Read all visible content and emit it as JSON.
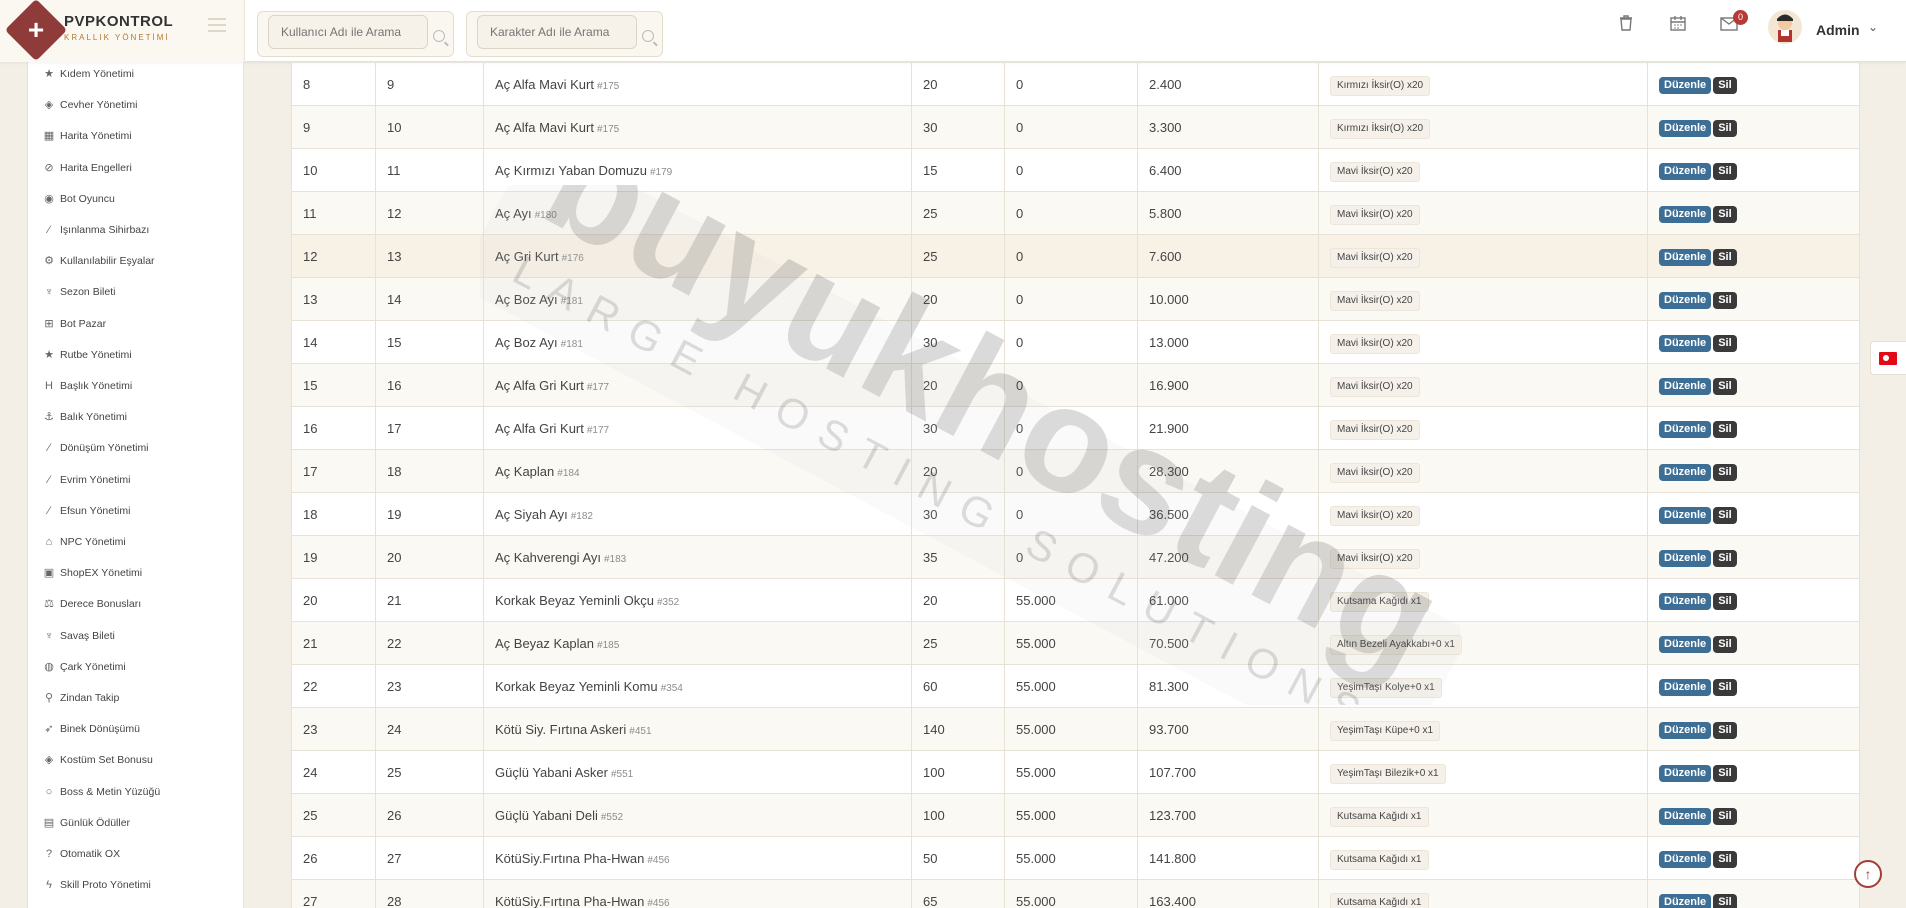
{
  "brand": {
    "title": "PVPKONTROL",
    "subtitle": "KRALLIK YÖNETİMİ"
  },
  "header": {
    "user_search_placeholder": "Kullanıcı Adı ile Arama",
    "char_search_placeholder": "Karakter Adı ile Arama",
    "notification_count": "0",
    "user_name": "Admin"
  },
  "sidebar": {
    "items": [
      {
        "label": "Kıdem Yönetimi",
        "icon": "star-icon"
      },
      {
        "label": "Cevher Yönetimi",
        "icon": "gem-icon"
      },
      {
        "label": "Harita Yönetimi",
        "icon": "map-icon"
      },
      {
        "label": "Harita Engelleri",
        "icon": "ban-icon"
      },
      {
        "label": "Bot Oyuncu",
        "icon": "bot-icon"
      },
      {
        "label": "Işınlanma Sihirbazı",
        "icon": "wand-icon"
      },
      {
        "label": "Kullanılabilir Eşyalar",
        "icon": "cogs-icon"
      },
      {
        "label": "Sezon Bileti",
        "icon": "trophy-icon"
      },
      {
        "label": "Bot Pazar",
        "icon": "cart-icon"
      },
      {
        "label": "Rutbe Yönetimi",
        "icon": "star-icon"
      },
      {
        "label": "Başlık Yönetimi",
        "icon": "heading-icon"
      },
      {
        "label": "Balık Yönetimi",
        "icon": "anchor-icon"
      },
      {
        "label": "Dönüşüm Yönetimi",
        "icon": "wand-icon"
      },
      {
        "label": "Evrim Yönetimi",
        "icon": "wand-icon"
      },
      {
        "label": "Efsun Yönetimi",
        "icon": "wand-icon"
      },
      {
        "label": "NPC Yönetimi",
        "icon": "bank-icon"
      },
      {
        "label": "ShopEX Yönetimi",
        "icon": "shop-icon"
      },
      {
        "label": "Derece Bonusları",
        "icon": "scale-icon"
      },
      {
        "label": "Savaş Bileti",
        "icon": "trophy-icon"
      },
      {
        "label": "Çark Yönetimi",
        "icon": "globe-icon"
      },
      {
        "label": "Zindan Takip",
        "icon": "pin-icon"
      },
      {
        "label": "Binek Dönüşümü",
        "icon": "rocket-icon"
      },
      {
        "label": "Kostüm Set Bonusu",
        "icon": "gem-icon"
      },
      {
        "label": "Boss & Metin Yüzüğü",
        "icon": "ring-icon"
      },
      {
        "label": "Günlük Ödüller",
        "icon": "calendar-icon"
      },
      {
        "label": "Otomatik OX",
        "icon": "question-icon"
      },
      {
        "label": "Skill Proto Yönetimi",
        "icon": "bolt-icon"
      }
    ]
  },
  "table": {
    "rows": [
      {
        "no": "8",
        "level": "9",
        "mob": "Aç Alfa Mavi Kurt",
        "mob_id": "#175",
        "count": "20",
        "yang": "0",
        "exp": "2.400",
        "item": "Kırmızı İksir(O) x20"
      },
      {
        "no": "9",
        "level": "10",
        "mob": "Aç Alfa Mavi Kurt",
        "mob_id": "#175",
        "count": "30",
        "yang": "0",
        "exp": "3.300",
        "item": "Kırmızı İksir(O) x20"
      },
      {
        "no": "10",
        "level": "11",
        "mob": "Aç Kırmızı Yaban Domuzu",
        "mob_id": "#179",
        "count": "15",
        "yang": "0",
        "exp": "6.400",
        "item": "Mavi İksir(O) x20"
      },
      {
        "no": "11",
        "level": "12",
        "mob": "Aç Ayı",
        "mob_id": "#180",
        "count": "25",
        "yang": "0",
        "exp": "5.800",
        "item": "Mavi İksir(O) x20"
      },
      {
        "no": "12",
        "level": "13",
        "mob": "Aç Gri Kurt",
        "mob_id": "#176",
        "count": "25",
        "yang": "0",
        "exp": "7.600",
        "item": "Mavi İksir(O) x20"
      },
      {
        "no": "13",
        "level": "14",
        "mob": "Aç Boz Ayı",
        "mob_id": "#181",
        "count": "20",
        "yang": "0",
        "exp": "10.000",
        "item": "Mavi İksir(O) x20"
      },
      {
        "no": "14",
        "level": "15",
        "mob": "Aç Boz Ayı",
        "mob_id": "#181",
        "count": "30",
        "yang": "0",
        "exp": "13.000",
        "item": "Mavi İksir(O) x20"
      },
      {
        "no": "15",
        "level": "16",
        "mob": "Aç Alfa Gri Kurt",
        "mob_id": "#177",
        "count": "20",
        "yang": "0",
        "exp": "16.900",
        "item": "Mavi İksir(O) x20"
      },
      {
        "no": "16",
        "level": "17",
        "mob": "Aç Alfa Gri Kurt",
        "mob_id": "#177",
        "count": "30",
        "yang": "0",
        "exp": "21.900",
        "item": "Mavi İksir(O) x20"
      },
      {
        "no": "17",
        "level": "18",
        "mob": "Aç Kaplan",
        "mob_id": "#184",
        "count": "20",
        "yang": "0",
        "exp": "28.300",
        "item": "Mavi İksir(O) x20"
      },
      {
        "no": "18",
        "level": "19",
        "mob": "Aç Siyah Ayı",
        "mob_id": "#182",
        "count": "30",
        "yang": "0",
        "exp": "36.500",
        "item": "Mavi İksir(O) x20"
      },
      {
        "no": "19",
        "level": "20",
        "mob": "Aç Kahverengi Ayı",
        "mob_id": "#183",
        "count": "35",
        "yang": "0",
        "exp": "47.200",
        "item": "Mavi İksir(O) x20"
      },
      {
        "no": "20",
        "level": "21",
        "mob": "Korkak Beyaz Yeminli Okçu",
        "mob_id": "#352",
        "count": "20",
        "yang": "55.000",
        "exp": "61.000",
        "item": "Kutsama Kağıdı x1"
      },
      {
        "no": "21",
        "level": "22",
        "mob": "Aç Beyaz Kaplan",
        "mob_id": "#185",
        "count": "25",
        "yang": "55.000",
        "exp": "70.500",
        "item": "Altın Bezeli Ayakkabı+0 x1"
      },
      {
        "no": "22",
        "level": "23",
        "mob": "Korkak Beyaz Yeminli Komu",
        "mob_id": "#354",
        "count": "60",
        "yang": "55.000",
        "exp": "81.300",
        "item": "YeşimTaşı Kolye+0 x1"
      },
      {
        "no": "23",
        "level": "24",
        "mob": "Kötü Siy. Fırtına Askeri",
        "mob_id": "#451",
        "count": "140",
        "yang": "55.000",
        "exp": "93.700",
        "item": "YeşimTaşı Küpe+0 x1"
      },
      {
        "no": "24",
        "level": "25",
        "mob": "Güçlü Yabani Asker",
        "mob_id": "#551",
        "count": "100",
        "yang": "55.000",
        "exp": "107.700",
        "item": "YeşimTaşı Bilezik+0 x1"
      },
      {
        "no": "25",
        "level": "26",
        "mob": "Güçlü Yabani Deli",
        "mob_id": "#552",
        "count": "100",
        "yang": "55.000",
        "exp": "123.700",
        "item": "Kutsama Kağıdı x1"
      },
      {
        "no": "26",
        "level": "27",
        "mob": "KötüSiy.Fırtına Pha-Hwan",
        "mob_id": "#456",
        "count": "50",
        "yang": "55.000",
        "exp": "141.800",
        "item": "Kutsama Kağıdı x1"
      },
      {
        "no": "27",
        "level": "28",
        "mob": "KötüSiy.Fırtına Pha-Hwan",
        "mob_id": "#456",
        "count": "65",
        "yang": "55.000",
        "exp": "163.400",
        "item": "Kutsama Kağıdı x1"
      }
    ],
    "edit_label": "Düzenle",
    "delete_label": "Sil"
  },
  "watermark": {
    "main": "buyukhosting",
    "sub": "LARGE HOSTING SOLUTIONS"
  },
  "colors": {
    "edit_button": "#3d6e96",
    "delete_button": "#3a3a3a",
    "brand": "#8e3b39",
    "badge": "#b63a36"
  }
}
